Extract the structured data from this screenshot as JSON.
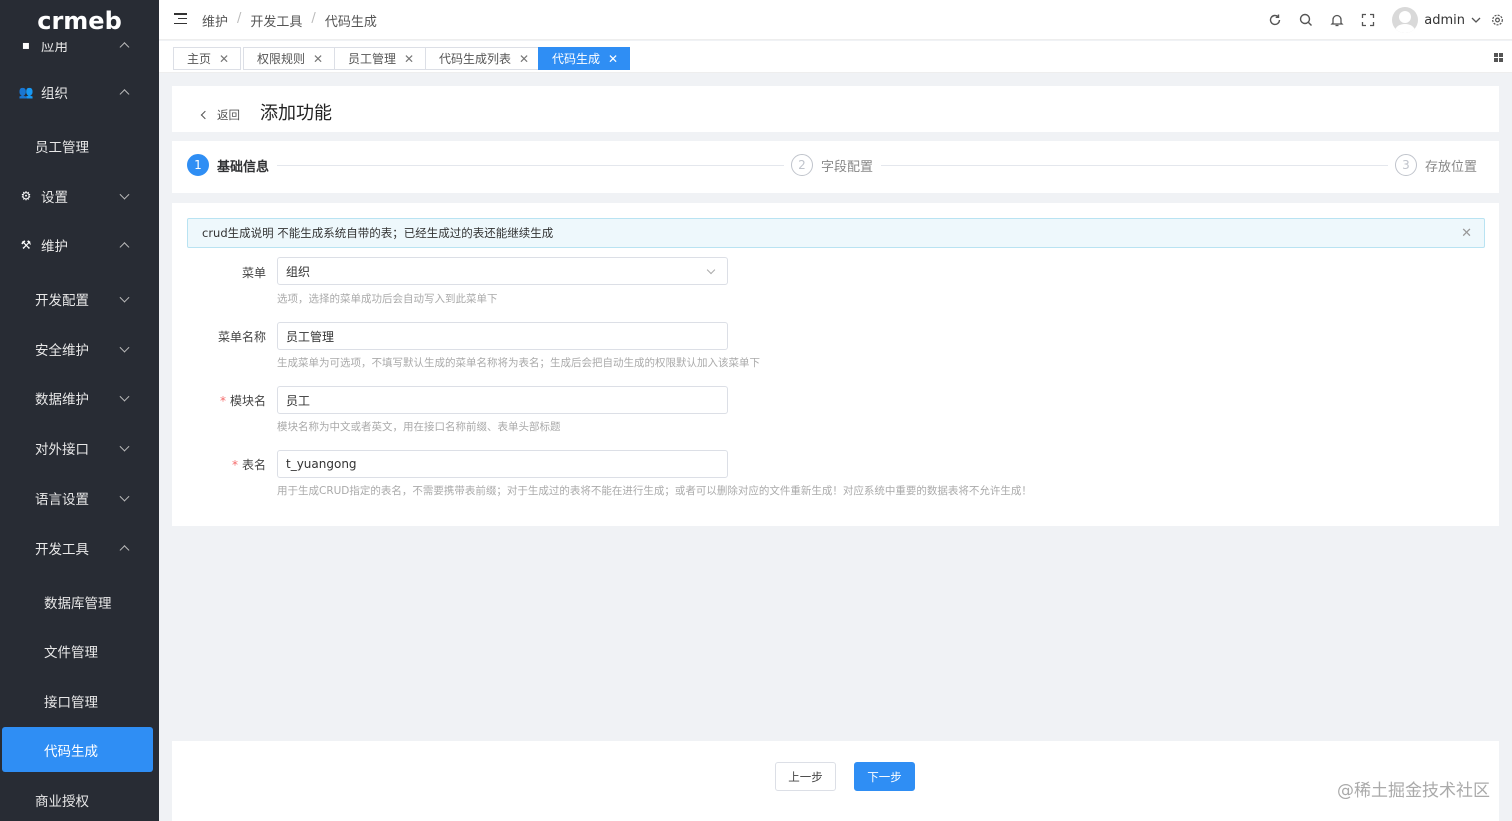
{
  "logo": "crmeb",
  "sidebar": {
    "items": [
      {
        "label": "应用",
        "icon": "app-icon",
        "expand": "up"
      },
      {
        "label": "组织",
        "icon": "team-icon",
        "expand": "up"
      },
      {
        "label": "员工管理"
      },
      {
        "label": "设置",
        "icon": "gear-icon",
        "expand": "down"
      },
      {
        "label": "维护",
        "icon": "hammer-icon",
        "expand": "up"
      },
      {
        "label": "开发配置",
        "expand": "down"
      },
      {
        "label": "安全维护",
        "expand": "down"
      },
      {
        "label": "数据维护",
        "expand": "down"
      },
      {
        "label": "对外接口",
        "expand": "down"
      },
      {
        "label": "语言设置",
        "expand": "down"
      },
      {
        "label": "开发工具",
        "expand": "up"
      },
      {
        "label": "数据库管理"
      },
      {
        "label": "文件管理"
      },
      {
        "label": "接口管理"
      },
      {
        "label": "代码生成",
        "active": true
      },
      {
        "label": "商业授权"
      }
    ]
  },
  "header": {
    "breadcrumb": [
      "维护",
      "开发工具",
      "代码生成"
    ],
    "user": "admin",
    "icons": [
      "refresh-icon",
      "search-icon",
      "bell-icon",
      "fullscreen-icon",
      "settings-icon"
    ]
  },
  "tabs": [
    {
      "label": "主页"
    },
    {
      "label": "权限规则"
    },
    {
      "label": "员工管理"
    },
    {
      "label": "代码生成列表"
    },
    {
      "label": "代码生成",
      "active": true
    }
  ],
  "page": {
    "back": "返回",
    "title": "添加功能"
  },
  "steps": [
    {
      "num": "1",
      "label": "基础信息",
      "active": true
    },
    {
      "num": "2",
      "label": "字段配置"
    },
    {
      "num": "3",
      "label": "存放位置"
    }
  ],
  "alert": "crud生成说明 不能生成系统自带的表；已经生成过的表还能继续生成",
  "form": {
    "menu": {
      "label": "菜单",
      "value": "组织",
      "help": "选项，选择的菜单成功后会自动写入到此菜单下"
    },
    "menu_name": {
      "label": "菜单名称",
      "value": "员工管理",
      "help": "生成菜单为可选项，不填写默认生成的菜单名称将为表名；生成后会把自动生成的权限默认加入该菜单下"
    },
    "module": {
      "label": "模块名",
      "value": "员工",
      "help": "模块名称为中文或者英文，用在接口名称前缀、表单头部标题"
    },
    "table": {
      "label": "表名",
      "value": "t_yuangong",
      "help": "用于生成CRUD指定的表名，不需要携带表前缀；对于生成过的表将不能在进行生成；或者可以删除对应的文件重新生成！对应系统中重要的数据表将不允许生成！"
    }
  },
  "buttons": {
    "prev": "上一步",
    "next": "下一步"
  },
  "watermark": "@稀土掘金技术社区",
  "colors": {
    "primary": "#2f8ef4",
    "sidebar_bg": "#282c34"
  }
}
